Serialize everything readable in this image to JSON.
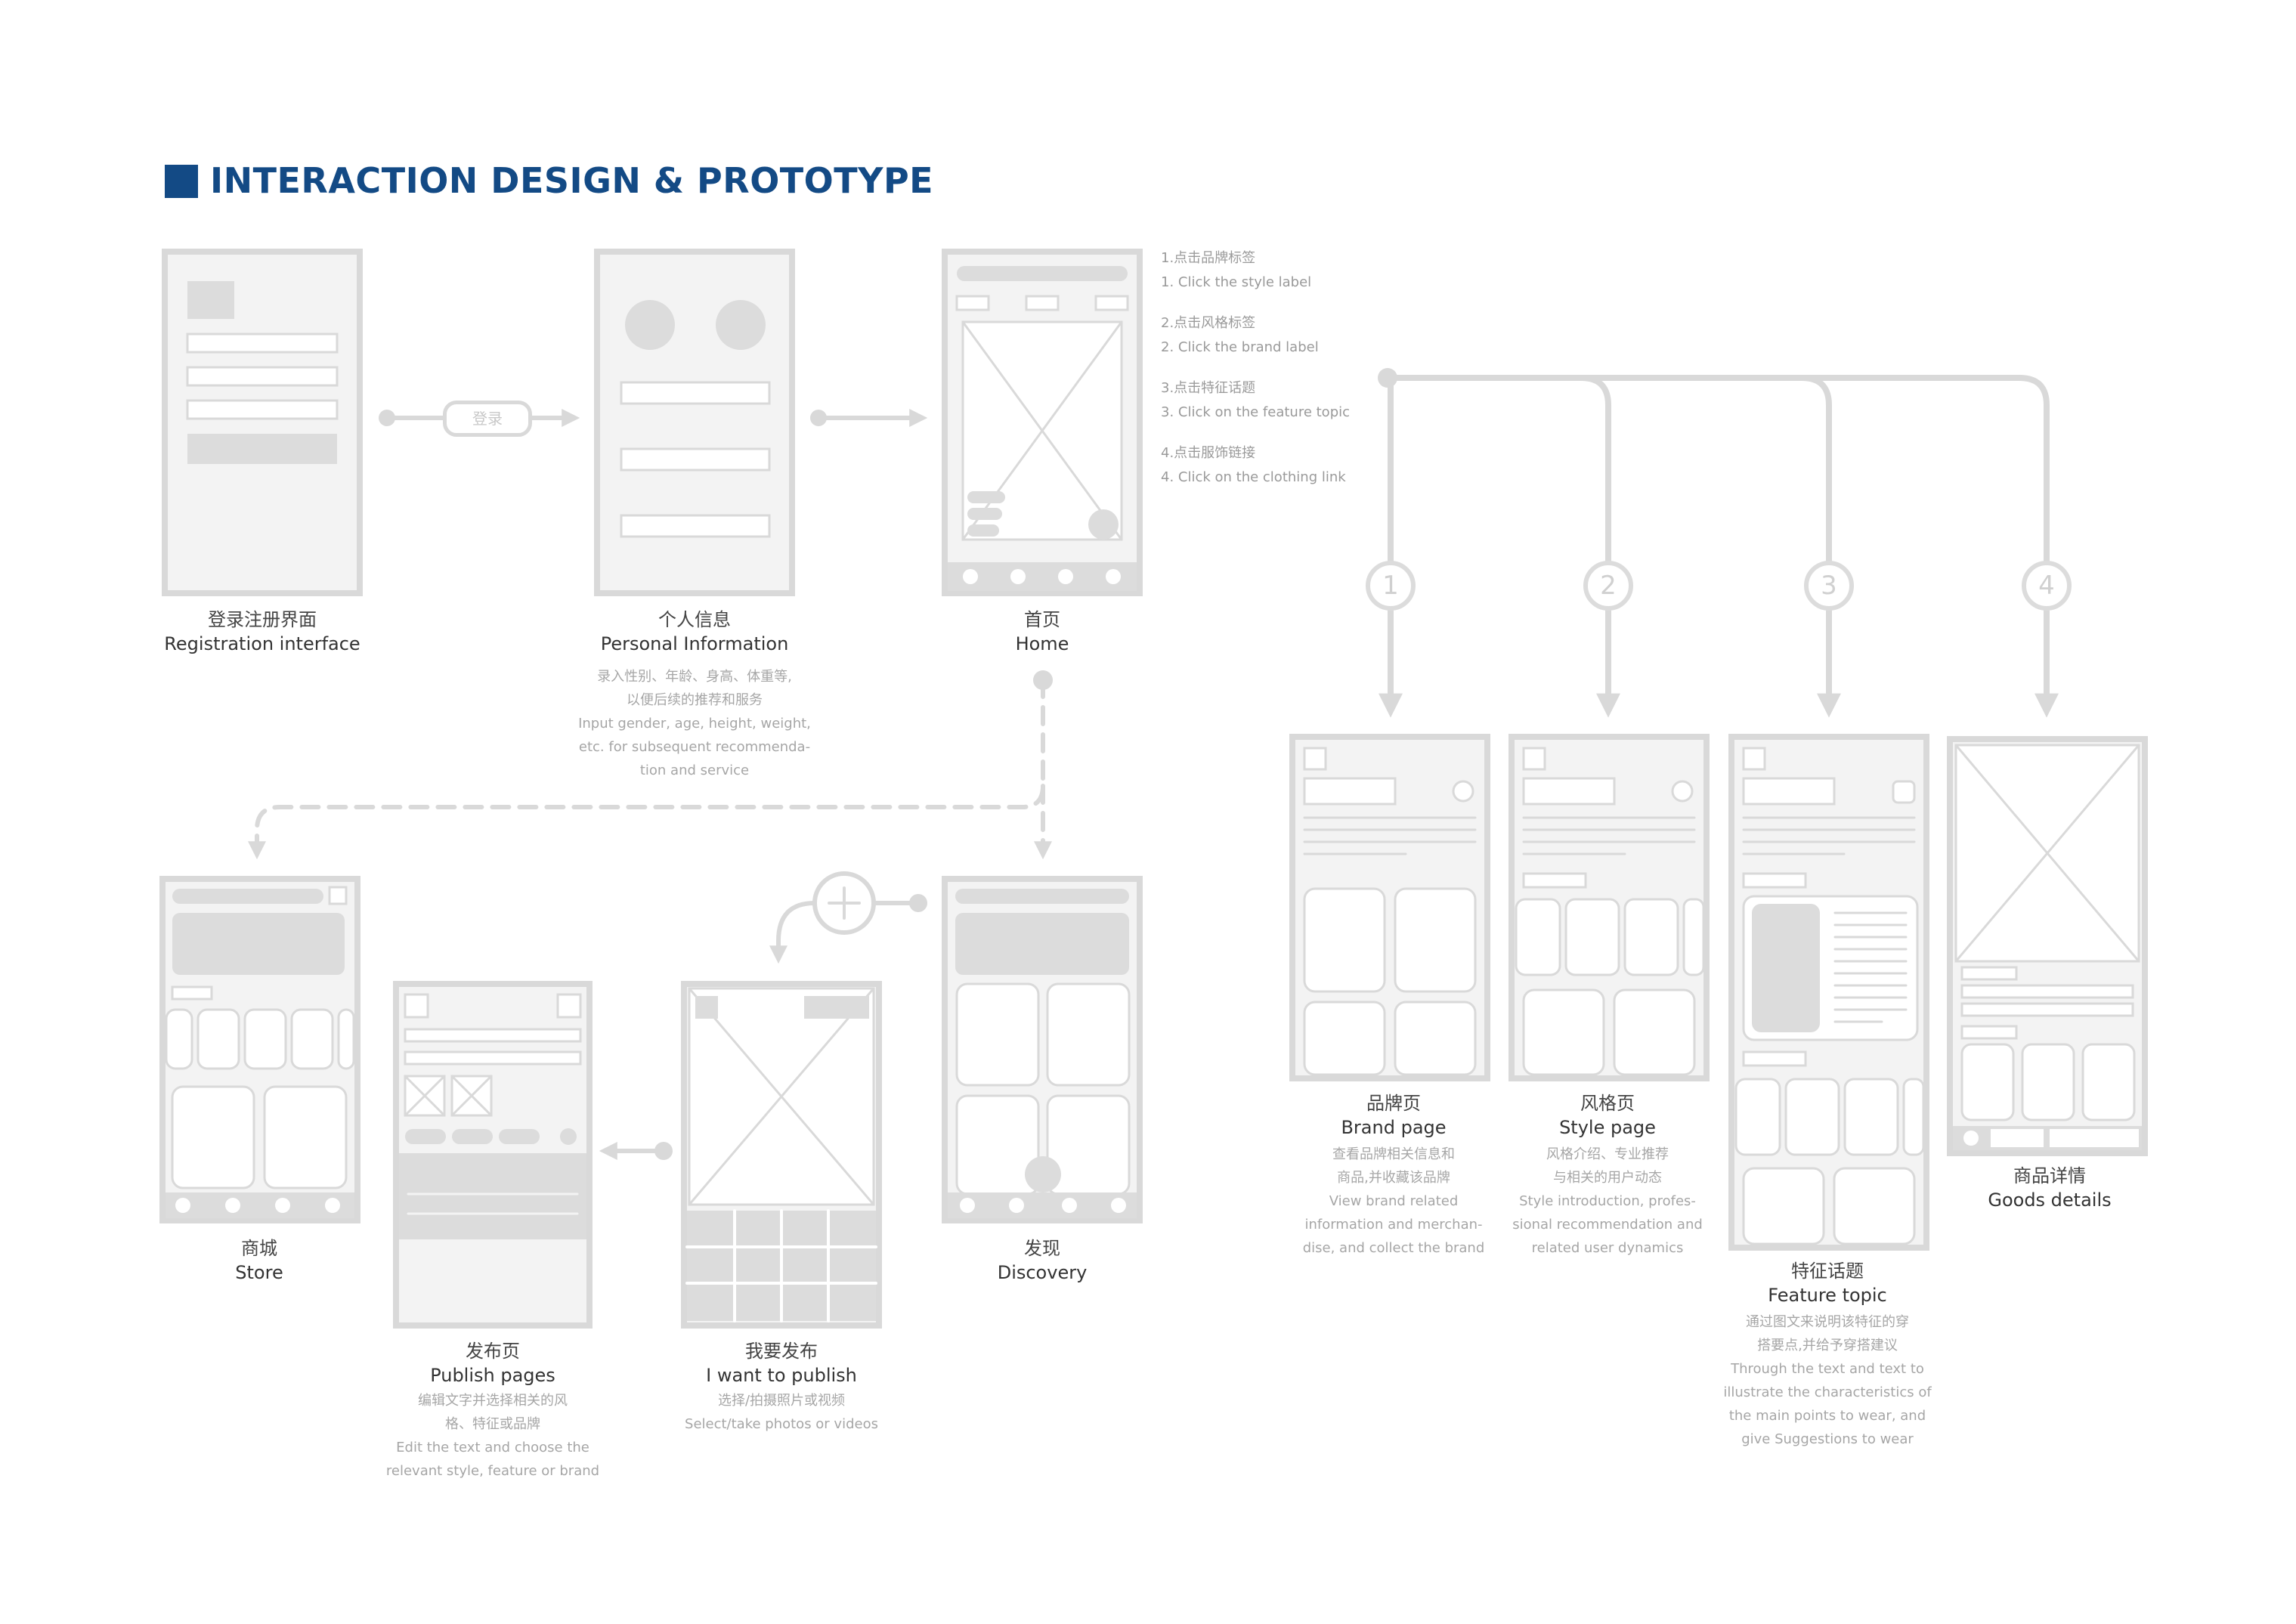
{
  "header": {
    "title": "INTERACTION DESIGN & PROTOTYPE"
  },
  "colors": {
    "accent": "#134a85",
    "wire": "#d9d9d9",
    "fill": "#f3f3f3",
    "text_muted": "#a6a6a6"
  },
  "login_button": "登录",
  "steps": [
    {
      "zh": "1.点击品牌标签",
      "en": "1. Click the style label"
    },
    {
      "zh": "2.点击风格标签",
      "en": "2. Click the brand label"
    },
    {
      "zh": "3.点击特征话题",
      "en": "3. Click on the feature topic"
    },
    {
      "zh": "4.点击服饰链接",
      "en": "4. Click on the clothing link"
    }
  ],
  "branch_numbers": [
    "1",
    "2",
    "3",
    "4"
  ],
  "screens": {
    "registration": {
      "zh": "登录注册界面",
      "en": "Registration interface"
    },
    "personal": {
      "zh": "个人信息",
      "en": "Personal Information",
      "desc": [
        "录入性别、年龄、身高、体重等,",
        "以便后续的推荐和服务",
        "Input gender, age, height, weight,",
        "etc. for subsequent recommenda-",
        "tion and service"
      ]
    },
    "home": {
      "zh": "首页",
      "en": "Home"
    },
    "store": {
      "zh": "商城",
      "en": "Store"
    },
    "publish_page": {
      "zh": "发布页",
      "en": "Publish pages",
      "desc": [
        "编辑文字并选择相关的风",
        "格、特征或品牌",
        "Edit the text and choose the",
        "relevant style, feature or brand"
      ]
    },
    "want_publish": {
      "zh": "我要发布",
      "en": "I want to publish",
      "desc": [
        "选择/拍摄照片或视频",
        "Select/take photos or videos"
      ]
    },
    "discovery": {
      "zh": "发现",
      "en": "Discovery"
    },
    "brand": {
      "zh": "品牌页",
      "en": "Brand page",
      "desc": [
        "查看品牌相关信息和",
        "商品,并收藏该品牌",
        "View brand related",
        "information and merchan-",
        "dise, and collect the brand"
      ]
    },
    "style": {
      "zh": "风格页",
      "en": "Style page",
      "desc": [
        "风格介绍、专业推荐",
        "与相关的用户动态",
        "Style introduction, profes-",
        "sional recommendation and",
        "related user dynamics"
      ]
    },
    "feature": {
      "zh": "特征话题",
      "en": "Feature topic",
      "desc": [
        "通过图文来说明该特征的穿",
        "搭要点,并给予穿搭建议",
        "Through the text and text to",
        "illustrate the characteristics of",
        "the main points to wear, and",
        "give Suggestions to wear"
      ]
    },
    "goods": {
      "zh": "商品详情",
      "en": "Goods details"
    }
  }
}
